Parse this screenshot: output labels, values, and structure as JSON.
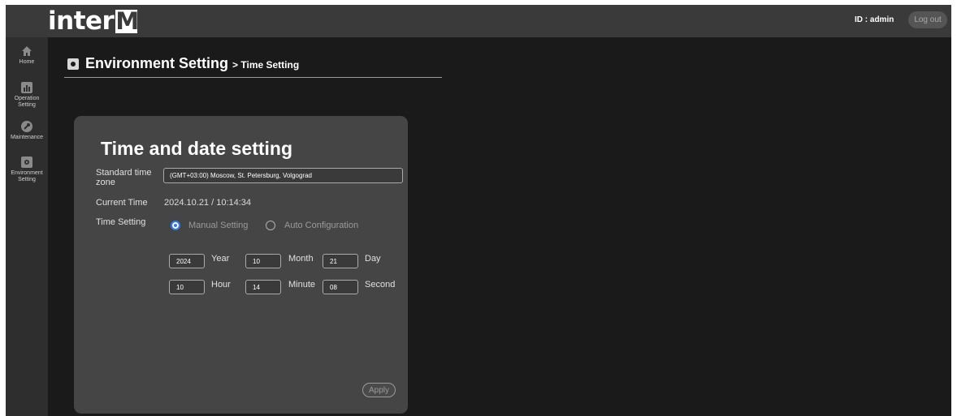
{
  "header": {
    "logo_text": "inter",
    "logo_m": "M",
    "user_id": "ID : admin",
    "logout_label": "Log out"
  },
  "sidebar": {
    "items": [
      {
        "label": "Home",
        "icon": "home-icon"
      },
      {
        "label": "Operation Setting",
        "icon": "bar-chart-icon"
      },
      {
        "label": "Maintenance",
        "icon": "wrench-icon"
      },
      {
        "label": "Environment Setting",
        "icon": "gear-icon"
      }
    ]
  },
  "page": {
    "title": "Environment Setting",
    "subtitle": "> Time Setting"
  },
  "panel": {
    "title": "Time and date setting",
    "timezone_label": "Standard time zone",
    "timezone_value": "(GMT+03:00) Moscow, St. Petersburg, Volgograd",
    "current_time_label": "Current Time",
    "current_time_value": "2024.10.21 / 10:14:34",
    "time_setting_label": "Time Setting",
    "manual_label": "Manual Setting",
    "auto_label": "Auto Configuration",
    "selected_mode": "Manual Setting",
    "year_value": "2024",
    "year_label": "Year",
    "month_value": "10",
    "month_label": "Month",
    "day_value": "21",
    "day_label": "Day",
    "hour_value": "10",
    "hour_label": "Hour",
    "minute_value": "14",
    "minute_label": "Minute",
    "second_value": "08",
    "second_label": "Second",
    "apply_label": "Apply"
  },
  "colors": {
    "background": "#1a1a1a",
    "header": "#3a3a3a",
    "sidebar": "#2e2e2e",
    "panel": "#454545",
    "accent": "#2f7be8"
  }
}
